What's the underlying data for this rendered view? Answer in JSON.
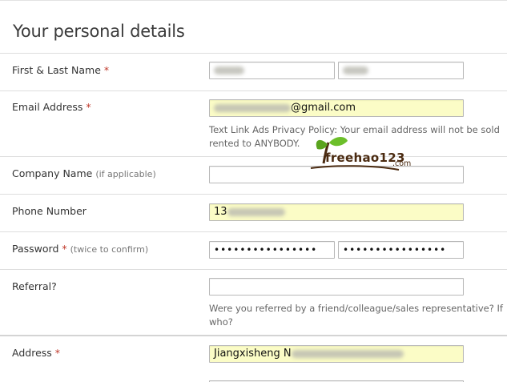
{
  "form": {
    "title": "Your personal details",
    "fields": {
      "name": {
        "label": "First & Last Name",
        "required_mark": "*",
        "first_value_visible": "",
        "last_value_visible": ""
      },
      "email": {
        "label": "Email Address",
        "required_mark": "*",
        "value_suffix": "@gmail.com",
        "help_line1": "Text Link Ads Privacy Policy: Your email address will not be sold",
        "help_line2": "rented to ANYBODY."
      },
      "company": {
        "label": "Company Name",
        "hint": "(if applicable)",
        "value": ""
      },
      "phone": {
        "label": "Phone Number",
        "value_prefix": "13"
      },
      "password": {
        "label": "Password",
        "required_mark": "*",
        "hint": "(twice to confirm)",
        "mask1": "••••••••••••••••",
        "mask2": "••••••••••••••••"
      },
      "referral": {
        "label": "Referral?",
        "value": "",
        "help_line1": "Were you referred by a friend/colleague/sales representative? If",
        "help_line2": "who?"
      },
      "address": {
        "label": "Address",
        "required_mark": "*",
        "value_prefix": "Jiangxisheng N"
      }
    }
  },
  "watermark": {
    "logo_text": "freehao123",
    "domain": ".com"
  },
  "colors": {
    "autofill_bg": "#fbfcc6",
    "required_red": "#c0392b",
    "border": "#b8b8b8",
    "logo_green": "#5aa41e",
    "logo_brown": "#4a2a10"
  }
}
